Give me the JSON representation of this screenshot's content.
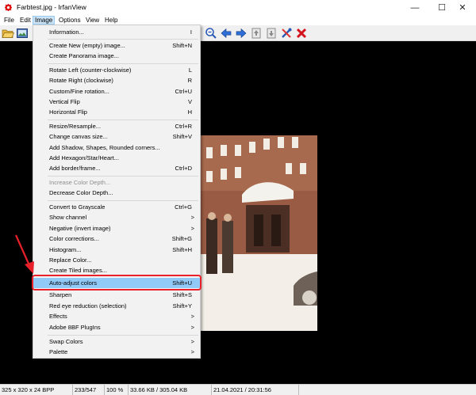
{
  "window": {
    "title": "Farbtest.jpg - IrfanView",
    "minimize_glyph": "—",
    "maximize_glyph": "☐",
    "close_glyph": "✕"
  },
  "menubar": [
    {
      "label": "File"
    },
    {
      "label": "Edit"
    },
    {
      "label": "Image"
    },
    {
      "label": "Options"
    },
    {
      "label": "View"
    },
    {
      "label": "Help"
    }
  ],
  "image_menu": {
    "information": {
      "label": "Information...",
      "shortcut": "I"
    },
    "create_new": {
      "label": "Create New (empty) image...",
      "shortcut": "Shift+N"
    },
    "create_panorama": {
      "label": "Create Panorama image..."
    },
    "rotate_left": {
      "label": "Rotate Left (counter-clockwise)",
      "shortcut": "L"
    },
    "rotate_right": {
      "label": "Rotate Right (clockwise)",
      "shortcut": "R"
    },
    "custom_rotation": {
      "label": "Custom/Fine rotation...",
      "shortcut": "Ctrl+U"
    },
    "vertical_flip": {
      "label": "Vertical Flip",
      "shortcut": "V"
    },
    "horizontal_flip": {
      "label": "Horizontal Flip",
      "shortcut": "H"
    },
    "resize": {
      "label": "Resize/Resample...",
      "shortcut": "Ctrl+R"
    },
    "change_canvas": {
      "label": "Change canvas size...",
      "shortcut": "Shift+V"
    },
    "add_shadow": {
      "label": "Add Shadow, Shapes, Rounded corners..."
    },
    "add_hexagon": {
      "label": "Add Hexagon/Star/Heart..."
    },
    "add_border": {
      "label": "Add border/frame...",
      "shortcut": "Ctrl+D"
    },
    "increase_depth": {
      "label": "Increase Color Depth..."
    },
    "decrease_depth": {
      "label": "Decrease Color Depth..."
    },
    "grayscale": {
      "label": "Convert to Grayscale",
      "shortcut": "Ctrl+G"
    },
    "show_channel": {
      "label": "Show channel",
      "arrow": ">"
    },
    "negative": {
      "label": "Negative (invert image)",
      "arrow": ">"
    },
    "color_corrections": {
      "label": "Color corrections...",
      "shortcut": "Shift+G"
    },
    "histogram": {
      "label": "Histogram...",
      "shortcut": "Shift+H"
    },
    "replace_color": {
      "label": "Replace Color..."
    },
    "create_tiled": {
      "label": "Create Tiled images..."
    },
    "auto_adjust": {
      "label": "Auto-adjust colors",
      "shortcut": "Shift+U"
    },
    "sharpen": {
      "label": "Sharpen",
      "shortcut": "Shift+S"
    },
    "red_eye": {
      "label": "Red eye reduction (selection)",
      "shortcut": "Shift+Y"
    },
    "effects": {
      "label": "Effects",
      "arrow": ">"
    },
    "adobe_8bf": {
      "label": "Adobe 8BF PlugIns",
      "arrow": ">"
    },
    "swap_colors": {
      "label": "Swap Colors",
      "arrow": ">"
    },
    "palette": {
      "label": "Palette",
      "arrow": ">"
    }
  },
  "status": {
    "dimensions": "325 x 320 x 24 BPP",
    "index": "233/547",
    "zoom": "100 %",
    "size": "33.66 KB / 305.04 KB",
    "datetime": "21.04.2021 / 20:31:56"
  },
  "icons": {
    "open": "folder-open-icon",
    "slideshow": "slideshow-icon",
    "zoom_out": "zoom-out-icon",
    "prev": "arrow-left-icon",
    "next": "arrow-right-icon",
    "page_up": "page-up-icon",
    "page_down": "page-down-icon",
    "tools": "tools-icon",
    "close": "close-red-icon"
  },
  "colors": {
    "highlight": "#91c9f7",
    "annotation": "#e8202a",
    "menu_active": "#cce4f7"
  }
}
